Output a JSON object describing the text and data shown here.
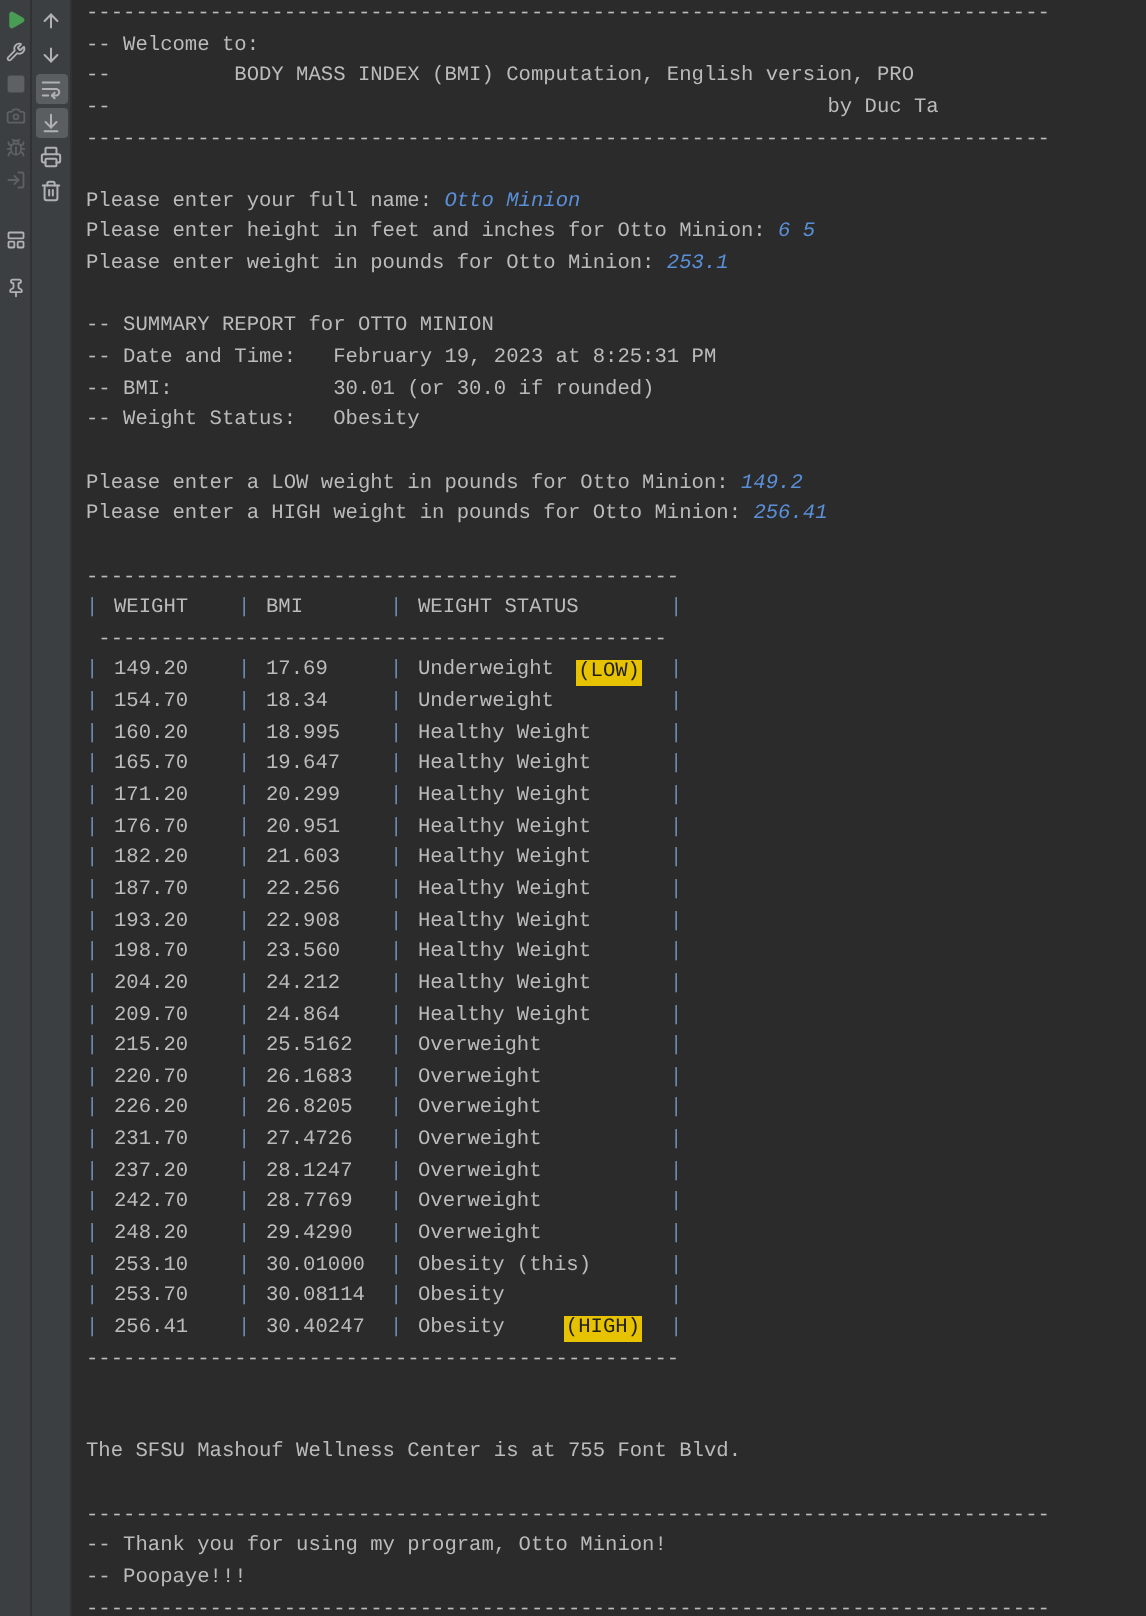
{
  "toolbar_left": [
    {
      "kind": "run",
      "disabled": false
    },
    {
      "kind": "wrench",
      "disabled": false
    },
    {
      "kind": "stop",
      "disabled": true
    },
    {
      "kind": "camera",
      "disabled": true
    },
    {
      "kind": "bug",
      "disabled": true
    },
    {
      "kind": "exit",
      "disabled": true
    },
    {
      "kind": "layout",
      "disabled": false
    },
    {
      "kind": "pin",
      "disabled": false
    }
  ],
  "toolbar_right": [
    {
      "kind": "up",
      "selected": false
    },
    {
      "kind": "down",
      "selected": false
    },
    {
      "kind": "wrap",
      "selected": true
    },
    {
      "kind": "scroll-end",
      "selected": true
    },
    {
      "kind": "print",
      "selected": false
    },
    {
      "kind": "trash",
      "selected": false
    }
  ],
  "console": [
    {
      "kind": "text",
      "text": "------------------------------------------------------------------------------"
    },
    {
      "kind": "text",
      "text": "-- Welcome to:"
    },
    {
      "kind": "text",
      "text": "--          BODY MASS INDEX (BMI) Computation, English version, PRO"
    },
    {
      "kind": "text",
      "text": "--                                                          by Duc Ta"
    },
    {
      "kind": "text",
      "text": "------------------------------------------------------------------------------"
    },
    {
      "kind": "blank"
    },
    {
      "kind": "prompt",
      "text": "Please enter your full name: ",
      "value": "Otto Minion"
    },
    {
      "kind": "prompt",
      "text": "Please enter height in feet and inches for Otto Minion: ",
      "value": "6 5"
    },
    {
      "kind": "prompt",
      "text": "Please enter weight in pounds for Otto Minion: ",
      "value": "253.1"
    },
    {
      "kind": "blank"
    },
    {
      "kind": "text",
      "text": "-- SUMMARY REPORT for OTTO MINION"
    },
    {
      "kind": "text",
      "text": "-- Date and Time:   February 19, 2023 at 8:25:31 PM"
    },
    {
      "kind": "text",
      "text": "-- BMI:             30.01 (or 30.0 if rounded)"
    },
    {
      "kind": "text",
      "text": "-- Weight Status:   Obesity"
    },
    {
      "kind": "blank"
    },
    {
      "kind": "prompt",
      "text": "Please enter a LOW weight in pounds for Otto Minion: ",
      "value": "149.2"
    },
    {
      "kind": "prompt",
      "text": "Please enter a HIGH weight in pounds for Otto Minion: ",
      "value": "256.41"
    },
    {
      "kind": "blank"
    },
    {
      "kind": "text",
      "text": "------------------------------------------------"
    },
    {
      "kind": "table",
      "separator": "|",
      "columns": [
        "WEIGHT",
        "BMI",
        "WEIGHT STATUS"
      ],
      "rule": " ----------------------------------------------",
      "rows": [
        {
          "weight": "149.20",
          "bmi": "17.69",
          "status": "Underweight",
          "tag": "(LOW)"
        },
        {
          "weight": "154.70",
          "bmi": "18.34",
          "status": "Underweight"
        },
        {
          "weight": "160.20",
          "bmi": "18.995",
          "status": "Healthy Weight"
        },
        {
          "weight": "165.70",
          "bmi": "19.647",
          "status": "Healthy Weight"
        },
        {
          "weight": "171.20",
          "bmi": "20.299",
          "status": "Healthy Weight"
        },
        {
          "weight": "176.70",
          "bmi": "20.951",
          "status": "Healthy Weight"
        },
        {
          "weight": "182.20",
          "bmi": "21.603",
          "status": "Healthy Weight"
        },
        {
          "weight": "187.70",
          "bmi": "22.256",
          "status": "Healthy Weight"
        },
        {
          "weight": "193.20",
          "bmi": "22.908",
          "status": "Healthy Weight"
        },
        {
          "weight": "198.70",
          "bmi": "23.560",
          "status": "Healthy Weight"
        },
        {
          "weight": "204.20",
          "bmi": "24.212",
          "status": "Healthy Weight"
        },
        {
          "weight": "209.70",
          "bmi": "24.864",
          "status": "Healthy Weight"
        },
        {
          "weight": "215.20",
          "bmi": "25.5162",
          "status": "Overweight"
        },
        {
          "weight": "220.70",
          "bmi": "26.1683",
          "status": "Overweight"
        },
        {
          "weight": "226.20",
          "bmi": "26.8205",
          "status": "Overweight"
        },
        {
          "weight": "231.70",
          "bmi": "27.4726",
          "status": "Overweight"
        },
        {
          "weight": "237.20",
          "bmi": "28.1247",
          "status": "Overweight"
        },
        {
          "weight": "242.70",
          "bmi": "28.7769",
          "status": "Overweight"
        },
        {
          "weight": "248.20",
          "bmi": "29.4290",
          "status": "Overweight"
        },
        {
          "weight": "253.10",
          "bmi": "30.01000",
          "status": "Obesity (this)"
        },
        {
          "weight": "253.70",
          "bmi": "30.08114",
          "status": "Obesity"
        },
        {
          "weight": "256.41",
          "bmi": "30.40247",
          "status": "Obesity",
          "tag": "(HIGH)"
        }
      ]
    },
    {
      "kind": "text",
      "text": "------------------------------------------------"
    },
    {
      "kind": "blank"
    },
    {
      "kind": "blank"
    },
    {
      "kind": "text",
      "text": "The SFSU Mashouf Wellness Center is at 755 Font Blvd."
    },
    {
      "kind": "blank"
    },
    {
      "kind": "text",
      "text": "------------------------------------------------------------------------------"
    },
    {
      "kind": "text",
      "text": "-- Thank you for using my program, Otto Minion!"
    },
    {
      "kind": "text",
      "text": "-- Poopaye!!!"
    },
    {
      "kind": "text",
      "text": "------------------------------------------------------------------------------"
    }
  ]
}
